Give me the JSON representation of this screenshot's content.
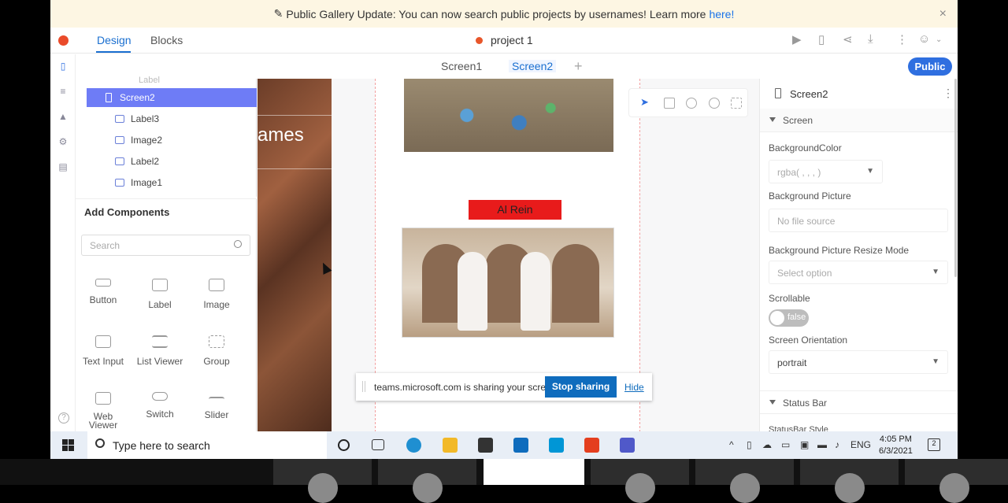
{
  "banner": {
    "text": "Public Gallery Update: You can now search public projects by usernames! Learn more",
    "link": "here!",
    "close": "×"
  },
  "topbar": {
    "tabs": [
      "Design",
      "Blocks"
    ],
    "project_title": "project 1"
  },
  "screen_tabs": {
    "tabs": [
      "Screen1",
      "Screen2"
    ],
    "add": "+",
    "public_button": "Public"
  },
  "tree": {
    "ghost_item": "Label",
    "selected": "Screen2",
    "items": [
      "Label3",
      "Image2",
      "Label2",
      "Image1"
    ]
  },
  "add_components": {
    "title": "Add Components",
    "search_placeholder": "Search",
    "components": [
      "Button",
      "Label",
      "Image",
      "Text Input",
      "List Viewer",
      "Group",
      "Web Viewer",
      "Switch",
      "Slider"
    ]
  },
  "canvas": {
    "strip_text": "ames",
    "red_button": "Al Rein"
  },
  "share_popup": {
    "message": "teams.microsoft.com is sharing your screen.",
    "stop_button": "Stop sharing",
    "hide_link": "Hide"
  },
  "properties": {
    "title": "Screen2",
    "section_screen": "Screen",
    "background_color_label": "BackgroundColor",
    "background_color_value": "rgba( , , , )",
    "background_picture_label": "Background Picture",
    "background_picture_value": "No file source",
    "resize_mode_label": "Background Picture Resize Mode",
    "resize_mode_value": "Select option",
    "scrollable_label": "Scrollable",
    "scrollable_value": "false",
    "orientation_label": "Screen Orientation",
    "orientation_value": "portrait",
    "section_status_bar": "Status Bar",
    "status_bar_style": "StatusBar Style"
  },
  "taskbar": {
    "search_placeholder": "Type here to search",
    "language": "ENG",
    "time": "4:05 PM",
    "date": "6/3/2021",
    "notifications": "2"
  },
  "colors": {
    "accent": "#2f6fe0",
    "selected_tree": "#6e7cf6",
    "red_button": "#e81b1b",
    "teams_blue": "#0f6cbd"
  }
}
